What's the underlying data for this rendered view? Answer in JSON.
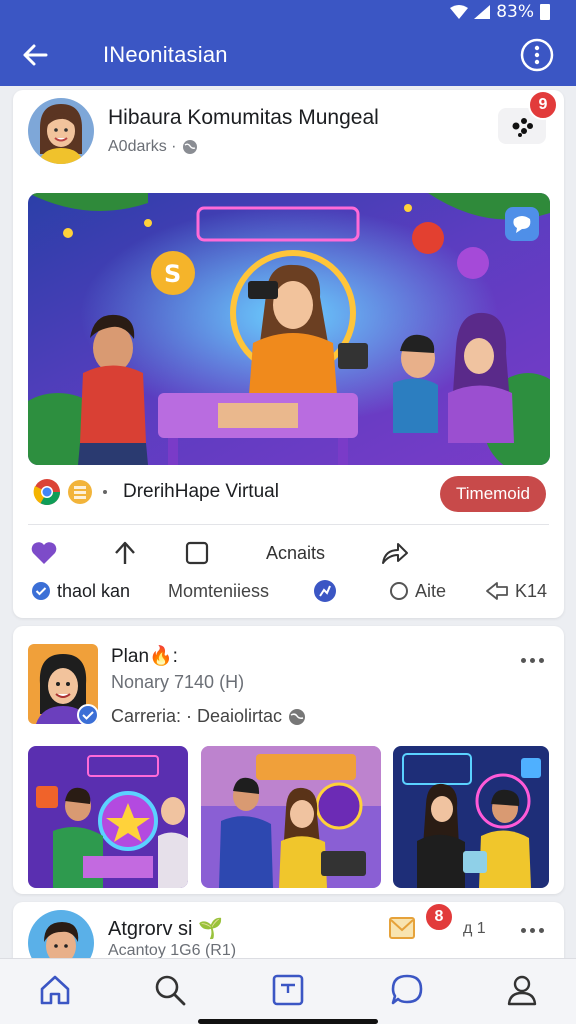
{
  "status_bar": {
    "battery": "83%",
    "icons": [
      "wifi-icon",
      "signal-icon",
      "battery-icon"
    ]
  },
  "app_bar": {
    "title": "INeonitasian",
    "back_icon": "arrow-left-icon",
    "menu_icon": "more-vertical-icon"
  },
  "post1": {
    "title": "Hibaura Komumitas Mungeal",
    "subtitle": "A0darks ·",
    "badge": "9",
    "reaction_text": "DrerihHape Virtual",
    "pill_label": "Timemoid",
    "actions": {
      "like_icon": "heart-icon",
      "share_up_icon": "arrow-up-icon",
      "save_icon": "bookmark-icon",
      "label": "Acnaits",
      "forward_icon": "share-arrow-icon"
    },
    "meta": {
      "author": "thaol kan",
      "comments": "Momteniiess",
      "likes": "Aite",
      "shares": "K14"
    }
  },
  "post2": {
    "title": "Plan🔥:",
    "subtitle": "Nonary 7140 (H)",
    "caption": "Carreria: · Deaiolirtac"
  },
  "post3": {
    "title": "Atgrorv si 🌱",
    "subtitle": "Acantoy 1G6 (R1)",
    "badge": "8",
    "count": "д 1"
  },
  "bottom_nav": [
    "home-icon",
    "search-icon",
    "compose-icon",
    "chat-icon",
    "profile-icon"
  ],
  "colors": {
    "primary": "#3b56c4",
    "pill": "#c84a4a",
    "badge": "#e23b3b",
    "nav_icon": "#3b56c4"
  }
}
